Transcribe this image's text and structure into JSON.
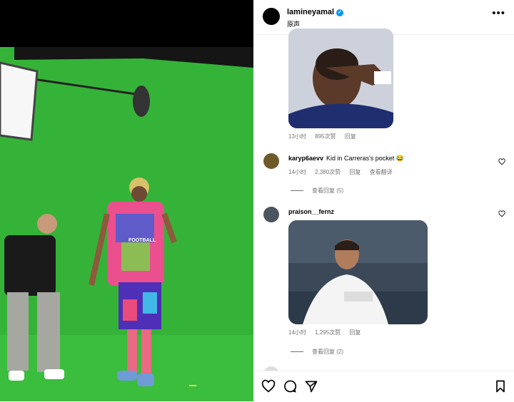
{
  "post": {
    "username": "lamineyamal",
    "audio": "原声"
  },
  "comments": [
    {
      "meta_time": "13小时",
      "meta_likes": "895次赞",
      "meta_reply": "回复"
    },
    {
      "user": "karyp6aevv",
      "text": "Kid in Carreras's pocket 😂",
      "time": "14小时",
      "likes": "2,380次赞",
      "reply": "回复",
      "translate": "查看翻译",
      "view_replies": "查看回复 (5)"
    },
    {
      "user": "praison__fernz",
      "time": "14小时",
      "likes": "1,295次赞",
      "reply": "回复",
      "view_replies": "查看回复 (2)"
    }
  ],
  "media": {
    "jersey_text": "FOOTBALL"
  },
  "icons": [
    "verified-icon",
    "more-icon",
    "heart-icon",
    "comment-icon",
    "share-icon",
    "bookmark-icon"
  ],
  "colors": {
    "green_screen": "#35b338",
    "verified": "#0095f6"
  }
}
